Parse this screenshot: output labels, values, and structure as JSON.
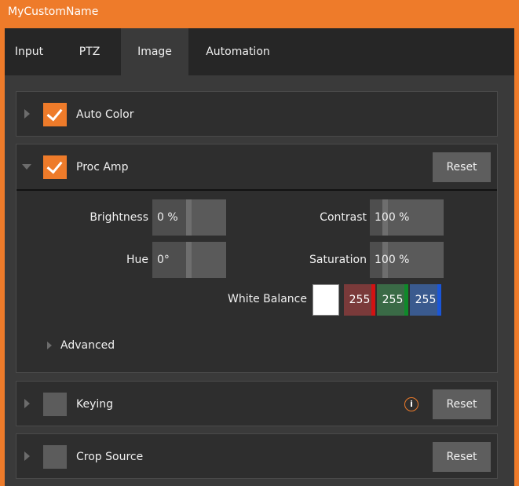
{
  "window": {
    "title": "MyCustomName"
  },
  "tabs": [
    {
      "label": "Input",
      "active": false
    },
    {
      "label": "PTZ",
      "active": false
    },
    {
      "label": "Image",
      "active": true
    },
    {
      "label": "Automation",
      "active": false
    }
  ],
  "sections": {
    "auto_color": {
      "label": "Auto Color",
      "checked": true,
      "expanded": false
    },
    "proc_amp": {
      "label": "Proc Amp",
      "checked": true,
      "expanded": true,
      "reset_label": "Reset",
      "brightness": {
        "label": "Brightness",
        "value": "0 %",
        "level": 0.5
      },
      "contrast": {
        "label": "Contrast",
        "value": "100 %",
        "level": 0.2
      },
      "hue": {
        "label": "Hue",
        "value": "0°",
        "level": 0.5
      },
      "saturation": {
        "label": "Saturation",
        "value": "100 %",
        "level": 0.2
      },
      "white_balance": {
        "label": "White Balance",
        "swatch_color": "#ffffff",
        "red": {
          "value": "255",
          "color": "#7a3a3a",
          "bar": "#d31212"
        },
        "green": {
          "value": "255",
          "color": "#3a6a46",
          "bar": "#0f8a2a"
        },
        "blue": {
          "value": "255",
          "color": "#3a5a8e",
          "bar": "#1a56d8"
        }
      },
      "advanced_label": "Advanced"
    },
    "keying": {
      "label": "Keying",
      "checked": false,
      "expanded": false,
      "reset_label": "Reset",
      "info_icon": "i"
    },
    "crop_source": {
      "label": "Crop Source",
      "checked": false,
      "expanded": false,
      "reset_label": "Reset"
    }
  },
  "colors": {
    "accent": "#ee7b2a",
    "panel": "#3a3a3a",
    "section": "#2e2e2e"
  }
}
